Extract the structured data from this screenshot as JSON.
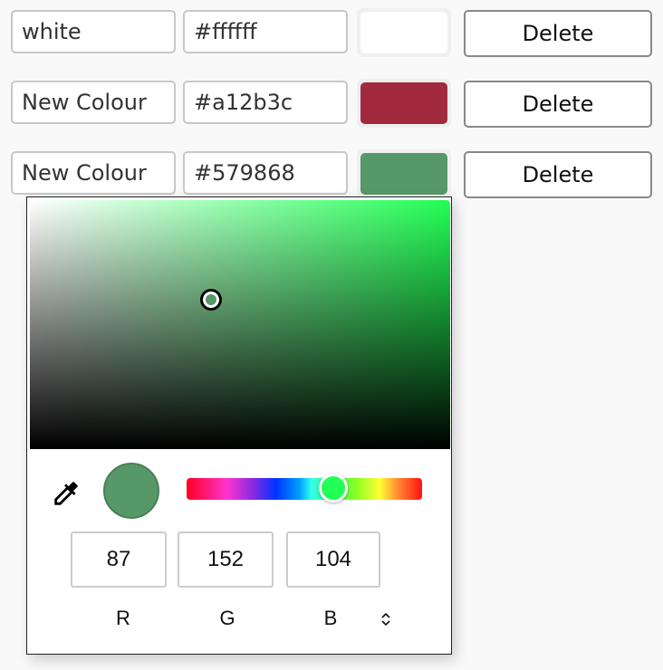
{
  "colours": [
    {
      "name": "white",
      "hex": "#ffffff",
      "display_hex": "#ffffff",
      "delete_label": "Delete"
    },
    {
      "name": "New Colour",
      "hex": "#a12b3c",
      "display_hex": "#a12b3c",
      "delete_label": "Delete"
    },
    {
      "name": "New Colour",
      "hex": "#579868",
      "display_hex": "#579868",
      "delete_label": "Delete"
    }
  ],
  "picker": {
    "current_hex": "#579868",
    "hue_degrees": 136,
    "hue_color": "#22ff55",
    "saturation": 0.43,
    "brightness": 0.6,
    "mode": "RGB",
    "channels": [
      {
        "label": "R",
        "value": "87"
      },
      {
        "label": "G",
        "value": "152"
      },
      {
        "label": "B",
        "value": "104"
      }
    ],
    "icons": {
      "eyedropper": "eyedropper-icon",
      "mode_toggle": "chevron-up-down-icon"
    }
  }
}
